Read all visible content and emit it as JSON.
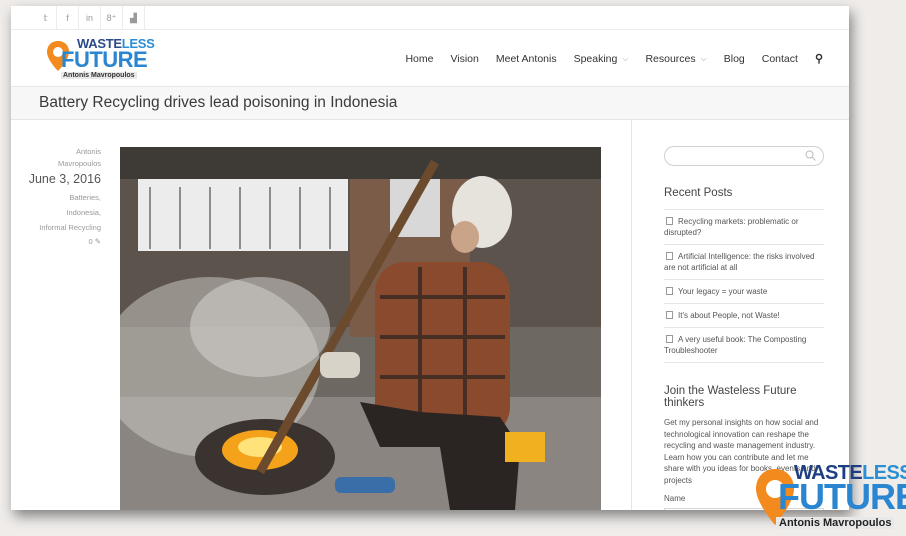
{
  "social": {
    "icons": [
      "twitter-icon",
      "facebook-icon",
      "linkedin-icon",
      "googleplus-icon",
      "youtube-icon"
    ],
    "glyphs": [
      "𝕥",
      "f",
      "in",
      "8⁺",
      "▟"
    ]
  },
  "logo": {
    "word_waste": "WASTE",
    "word_less": "LESS",
    "word_future": "FUTURE",
    "author": "Antonis Mavropoulos"
  },
  "nav": {
    "home": "Home",
    "vision": "Vision",
    "meet": "Meet Antonis",
    "speaking": "Speaking",
    "resources": "Resources",
    "blog": "Blog",
    "contact": "Contact",
    "chevron": "⌵",
    "search_glyph": "⚲"
  },
  "page": {
    "title": "Battery Recycling drives lead poisoning in Indonesia"
  },
  "post_meta": {
    "author_first": "Antonis",
    "author_last": "Mavropoulos",
    "date": "June 3, 2016",
    "cat1": "Batteries,",
    "cat2": "Indonesia,",
    "cat3": "Informal Recycling",
    "comments": "0 ✎"
  },
  "sidebar": {
    "search_placeholder": "",
    "recent_heading": "Recent Posts",
    "recent_posts": [
      "Recycling markets: problematic or disrupted?",
      "Artificial Intelligence: the risks involved are not artificial at all",
      "Your legacy = your waste",
      "It's about People, not Waste!",
      "A very useful book: The Composting Troubleshooter"
    ],
    "join_heading": "Join the Wasteless Future thinkers",
    "join_text": "Get my personal insights on how social and technological innovation can reshape the recycling and waste management industry. Learn how you can contribute and let me share with you ideas for books, events and projects",
    "name_label": "Name"
  },
  "colors": {
    "brand_blue": "#2a86d0",
    "brand_navy": "#2b4a8c",
    "brand_orange": "#f28a1e"
  }
}
